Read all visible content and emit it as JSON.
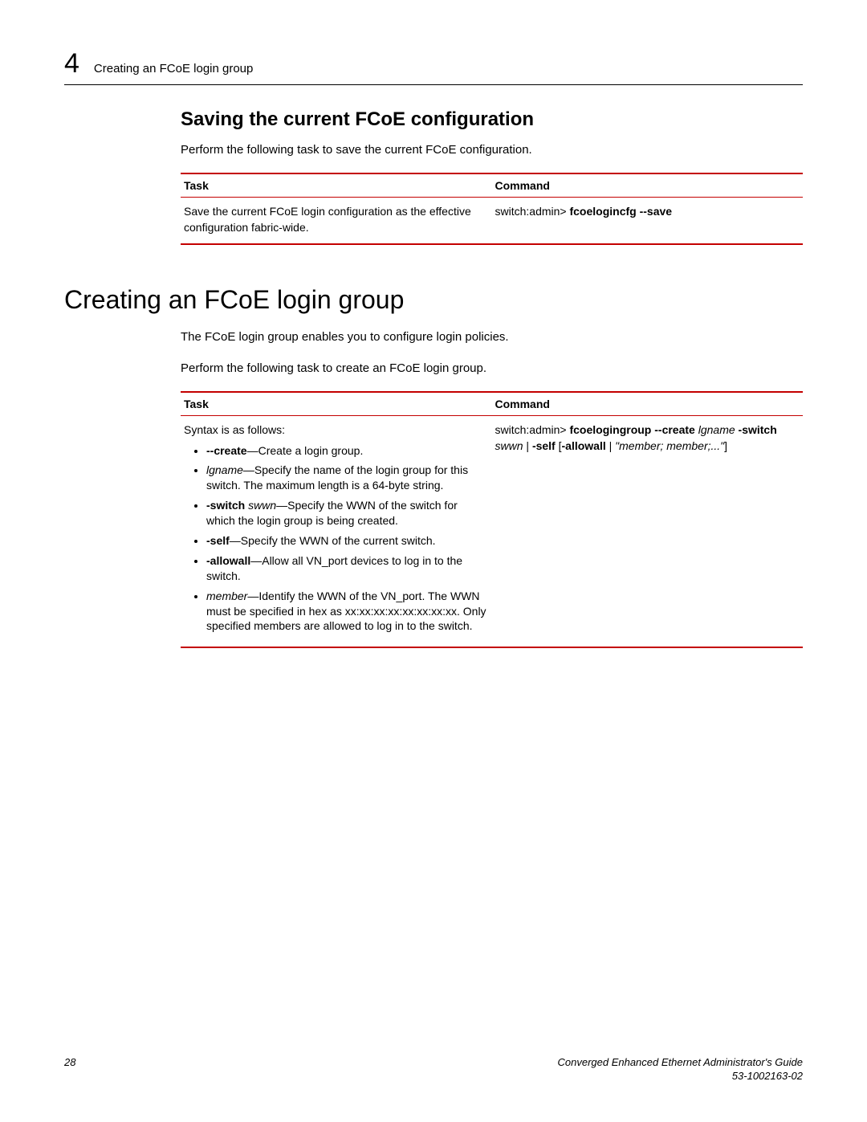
{
  "header": {
    "chapter_num": "4",
    "title": "Creating an FCoE login group"
  },
  "section1": {
    "heading": "Saving the current FCoE configuration",
    "intro": "Perform the following task to save the current FCoE configuration.",
    "table": {
      "col_task": "Task",
      "col_cmd": "Command",
      "row": {
        "task": "Save the current FCoE login configuration as the effective configuration fabric-wide.",
        "cmd_prefix": "switch:admin> ",
        "cmd_bold": "fcoelogincfg --save"
      }
    }
  },
  "section2": {
    "heading": "Creating an FCoE login group",
    "p1": "The FCoE login group enables you to configure login policies.",
    "p2": "Perform the following task to create an FCoE login group.",
    "table": {
      "col_task": "Task",
      "col_cmd": "Command",
      "syntax_intro": "Syntax is as follows:",
      "items": {
        "create_b": "--create",
        "create_rest": "—Create a login group.",
        "lgname_i": "lgname",
        "lgname_rest": "—Specify the name of the login group for this switch. The maximum length is a 64-byte string.",
        "switch_b": "-switch ",
        "switch_i": "swwn",
        "switch_rest": "—Specify the WWN of the switch for which the login group is being created.",
        "self_b": "-self",
        "self_rest": "—Specify the WWN of the current switch.",
        "allowall_b": "-allowall",
        "allowall_rest": "—Allow all VN_port devices to log in to the switch.",
        "member_i": "member",
        "member_rest": "—Identify the WWN of the VN_port. The WWN must be specified in hex as xx:xx:xx:xx:xx:xx:xx:xx. Only specified members are allowed to log in to the switch."
      },
      "cmd": {
        "prefix": "switch:admin> ",
        "b1": "fcoelogingroup --create ",
        "i1": "lgname ",
        "b2": "-switch ",
        "i2": "swwn ",
        "mid": "| ",
        "b3": "-self ",
        "open": "[",
        "b4": "-allowall",
        "mid2": " | ",
        "i3": "\"member; member;...\"",
        "close": "]"
      }
    }
  },
  "footer": {
    "page": "28",
    "guide": "Converged Enhanced Ethernet Administrator's Guide",
    "docnum": "53-1002163-02"
  },
  "chart_data": null
}
